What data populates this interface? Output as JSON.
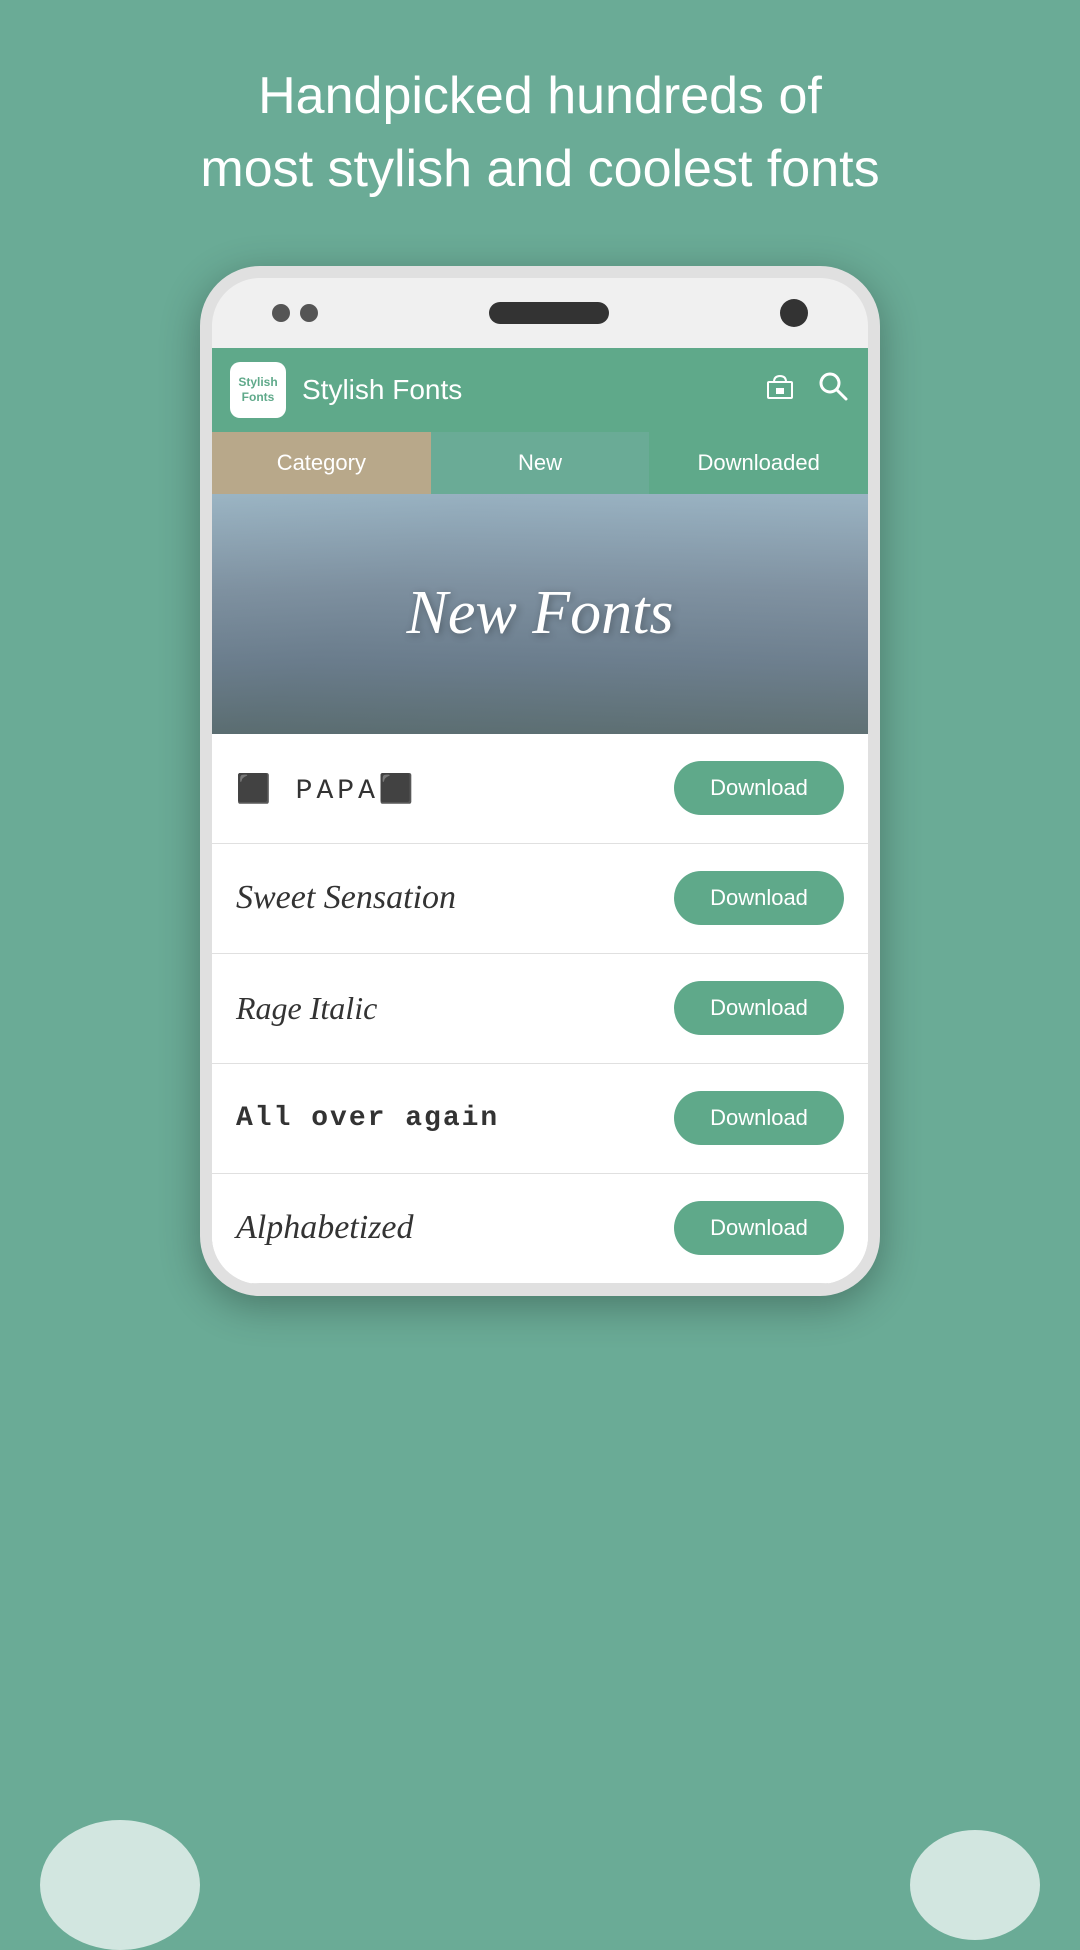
{
  "hero": {
    "line1": "Handpicked hundreds of",
    "line2": "most stylish and coolest fonts"
  },
  "appbar": {
    "icon_label": "Stylish\nFonts",
    "title": "Stylish Fonts"
  },
  "tabs": [
    {
      "id": "category",
      "label": "Category",
      "active": false
    },
    {
      "id": "new",
      "label": "New",
      "active": true
    },
    {
      "id": "downloaded",
      "label": "Downloaded",
      "active": false
    }
  ],
  "banner": {
    "text": "New Fonts"
  },
  "fonts": [
    {
      "id": "papa",
      "preview": "🚌 PAPA🚌",
      "style": "papa",
      "download_label": "Download"
    },
    {
      "id": "sweet-sensation",
      "preview": "Sweet Sensation",
      "style": "sweet",
      "download_label": "Download"
    },
    {
      "id": "rage-italic",
      "preview": "Rage Italic",
      "style": "rage",
      "download_label": "Download"
    },
    {
      "id": "all-over-again",
      "preview": "All over again",
      "style": "allover",
      "download_label": "Download"
    },
    {
      "id": "alphabetized",
      "preview": "Alphabetized",
      "style": "alpha",
      "download_label": "Download"
    }
  ],
  "colors": {
    "primary": "#5fa98a",
    "background": "#6aab96",
    "tab_category": "#b8a88a"
  }
}
